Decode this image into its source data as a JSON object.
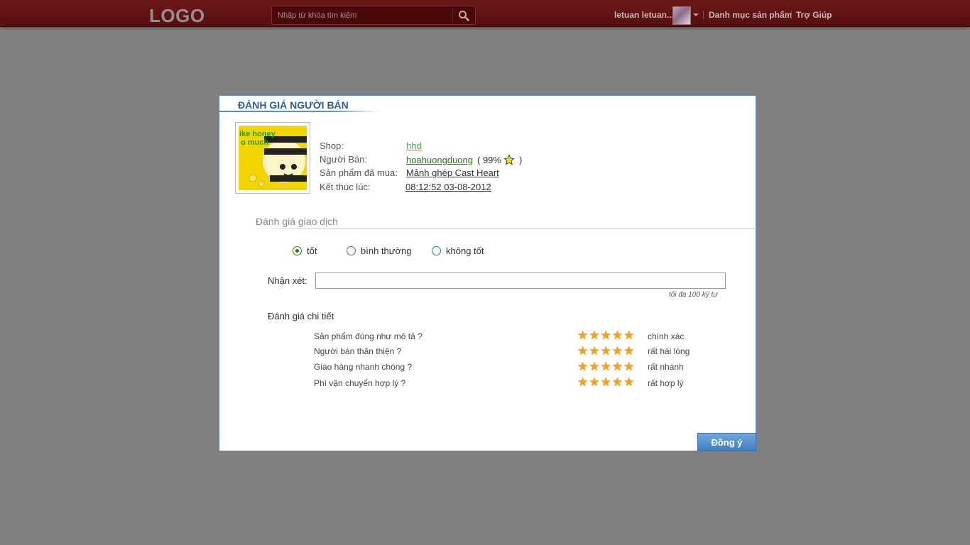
{
  "header": {
    "logo": "LOGO",
    "search_placeholder": "Nhập từ khóa tìm kiếm",
    "username": "letuan letuan...",
    "nav": [
      "Danh mục sản phẩm",
      "Trợ Giúp"
    ]
  },
  "modal": {
    "title": "ĐÁNH GIÁ NGƯỜI BÁN",
    "info": {
      "shop_label": "Shop:",
      "shop_value": "hhd",
      "seller_label": "Người Bán:",
      "seller_value": "hoahuongduong",
      "seller_rating_open": "( 99%",
      "seller_rating_close": ")",
      "product_label": "Sản phẩm đã mua:",
      "product_value": "Mảnh ghép Cast Heart",
      "ended_label": "Kết thúc lúc:",
      "ended_value": "08:12:52 03-08-2012"
    },
    "thumb_text": [
      "ike honey",
      "o much"
    ],
    "section_title": "Đánh giá giao dịch",
    "rating_options": [
      {
        "label": "tốt",
        "checked": true
      },
      {
        "label": "bình thường",
        "checked": false
      },
      {
        "label": "không tốt",
        "checked": false
      }
    ],
    "comment_label": "Nhận xét:",
    "comment_value": "",
    "comment_hint": "tối đa 100 ký tự",
    "detail_title": "Đánh giá chi tiết",
    "criteria": [
      {
        "label": "Sản phẩm đúng như mô tả ?",
        "stars": 5,
        "value": "chính xác"
      },
      {
        "label": "Người bán thân thiện ?",
        "stars": 5,
        "value": "rất hài lòng"
      },
      {
        "label": "Giao hàng nhanh chóng ?",
        "stars": 5,
        "value": "rất nhanh"
      },
      {
        "label": "Phí vận chuyển hợp lý ?",
        "stars": 5,
        "value": "rất hợp lý"
      }
    ],
    "submit_label": "Đồng ý"
  },
  "colors": {
    "topbar": "#5e1212",
    "backdrop": "#808080",
    "modal_border": "#5b8fc2",
    "title": "#2b5f95",
    "star": "#f7a11a",
    "button": "#4f8ecb"
  }
}
